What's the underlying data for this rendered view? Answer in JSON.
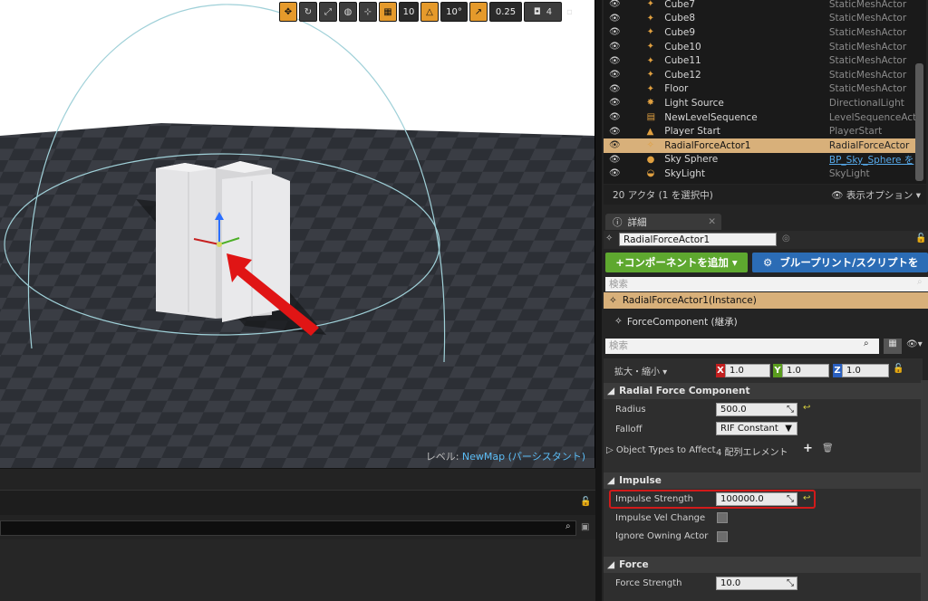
{
  "toolbar": {
    "grid": "10",
    "rotation": "10°",
    "scale": "0.25",
    "camera": "4"
  },
  "viewport": {
    "level_label": "レベル:",
    "level_name": "NewMap (パーシスタント)"
  },
  "outliner": {
    "rows": [
      {
        "name": "Cube7",
        "type": "StaticMeshActor"
      },
      {
        "name": "Cube8",
        "type": "StaticMeshActor"
      },
      {
        "name": "Cube9",
        "type": "StaticMeshActor"
      },
      {
        "name": "Cube10",
        "type": "StaticMeshActor"
      },
      {
        "name": "Cube11",
        "type": "StaticMeshActor"
      },
      {
        "name": "Cube12",
        "type": "StaticMeshActor"
      },
      {
        "name": "Floor",
        "type": "StaticMeshActor"
      },
      {
        "name": "Light Source",
        "type": "DirectionalLight"
      },
      {
        "name": "NewLevelSequence",
        "type": "LevelSequenceActor"
      },
      {
        "name": "Player Start",
        "type": "PlayerStart"
      },
      {
        "name": "RadialForceActor1",
        "type": "RadialForceActor"
      },
      {
        "name": "Sky Sphere",
        "type": "BP_Sky_Sphere を"
      },
      {
        "name": "SkyLight",
        "type": "SkyLight"
      }
    ],
    "footer": "20 アクタ (1 を選択中)",
    "view_options": "表示オプション"
  },
  "details": {
    "tab": "詳細",
    "actor_name": "RadialForceActor1",
    "add_component": "+コンポーネントを追加",
    "blueprint": "ブループリント/スクリプトを",
    "search_placeholder": "検索",
    "instance": "RadialForceActor1(Instance)",
    "component": "ForceComponent (継承)",
    "search2_placeholder": "検索",
    "scale_label": "拡大・縮小",
    "scale": {
      "x": "1.0",
      "y": "1.0",
      "z": "1.0"
    },
    "sections": {
      "radial": "Radial Force Component",
      "impulse": "Impulse",
      "force": "Force"
    },
    "radius_label": "Radius",
    "radius": "500.0",
    "falloff_label": "Falloff",
    "falloff": "RIF Constant",
    "objtypes_label": "Object Types to Affect",
    "objtypes": "4 配列エレメント",
    "impulse_strength_label": "Impulse Strength",
    "impulse_strength": "100000.0",
    "impulse_vel_label": "Impulse Vel Change",
    "ignore_owning_label": "Ignore Owning Actor",
    "force_strength_label": "Force Strength",
    "force_strength": "10.0"
  }
}
